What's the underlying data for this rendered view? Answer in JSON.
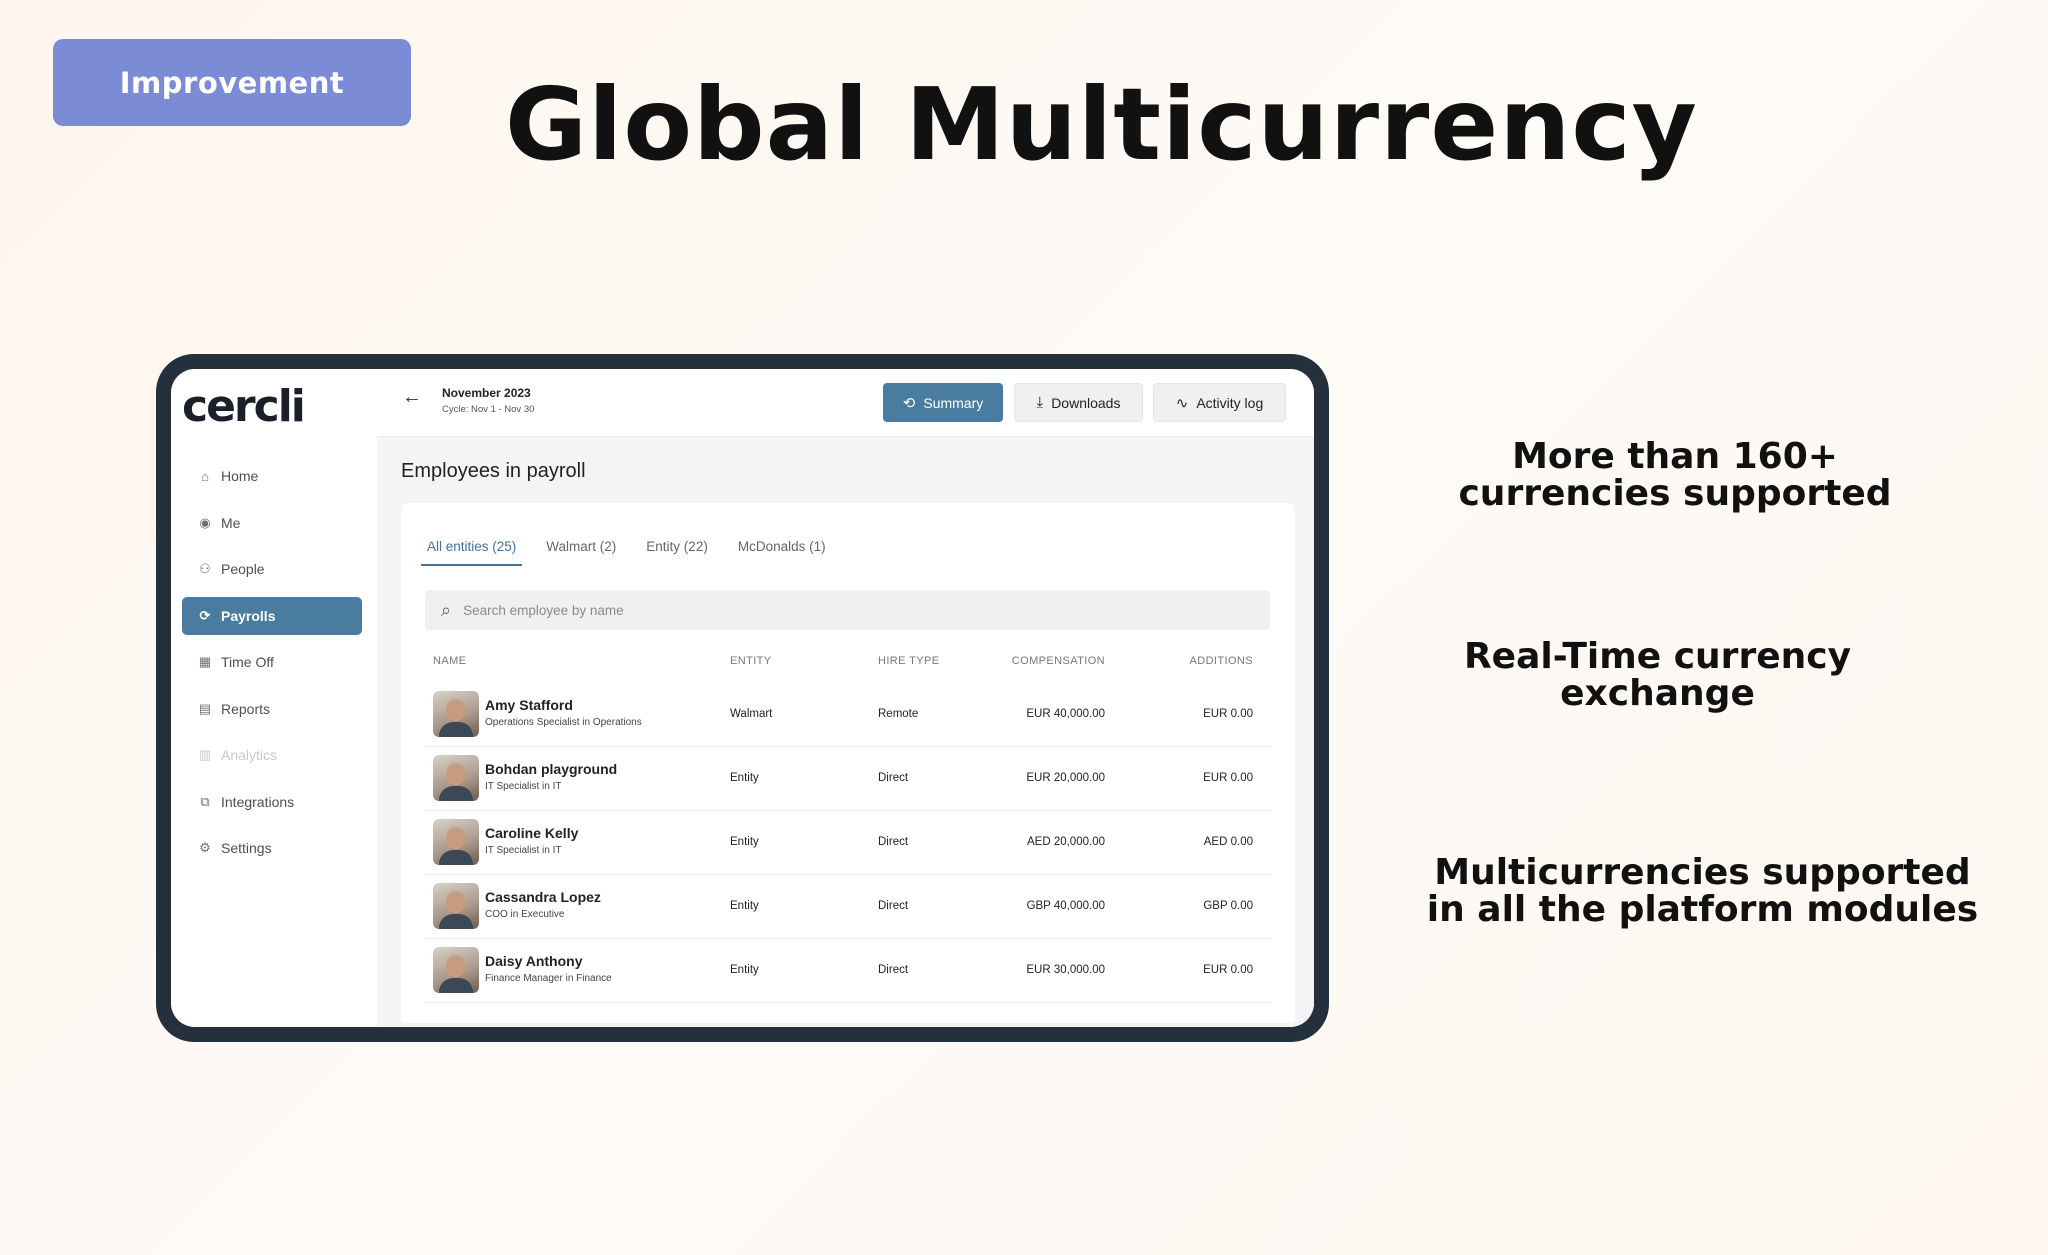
{
  "badge": "Improvement",
  "title": "Global Multicurrency",
  "features": [
    "More than 160+ currencies supported",
    "Real-Time currency exchange",
    "Multicurrencies supported in all the platform modules"
  ],
  "app": {
    "logo": "cercli",
    "nav": [
      {
        "label": "Home",
        "icon": "home-icon"
      },
      {
        "label": "Me",
        "icon": "user-circle-icon"
      },
      {
        "label": "People",
        "icon": "people-icon"
      },
      {
        "label": "Payrolls",
        "icon": "payroll-icon",
        "active": true
      },
      {
        "label": "Time Off",
        "icon": "calendar-icon"
      },
      {
        "label": "Reports",
        "icon": "document-icon"
      },
      {
        "label": "Analytics",
        "icon": "analytics-icon",
        "disabled": true
      },
      {
        "label": "Integrations",
        "icon": "integrations-icon"
      },
      {
        "label": "Settings",
        "icon": "gear-icon"
      }
    ],
    "header": {
      "month": "November 2023",
      "cycle": "Cycle: Nov 1 - Nov 30",
      "summary_label": "Summary",
      "downloads_label": "Downloads",
      "activity_label": "Activity log"
    },
    "section_title": "Employees in payroll",
    "tabs": [
      "All entities (25)",
      "Walmart (2)",
      "Entity (22)",
      "McDonalds (1)"
    ],
    "search_placeholder": "Search employee by name",
    "columns": {
      "name": "NAME",
      "entity": "ENTITY",
      "hire_type": "HIRE TYPE",
      "compensation": "COMPENSATION",
      "additions": "ADDITIONS"
    },
    "employees": [
      {
        "name": "Amy Stafford",
        "role": "Operations Specialist in Operations",
        "entity": "Walmart",
        "hire_type": "Remote",
        "compensation": "EUR 40,000.00",
        "additions": "EUR 0.00"
      },
      {
        "name": "Bohdan playground",
        "role": "IT Specialist in IT",
        "entity": "Entity",
        "hire_type": "Direct",
        "compensation": "EUR 20,000.00",
        "additions": "EUR 0.00"
      },
      {
        "name": "Caroline Kelly",
        "role": "IT Specialist in IT",
        "entity": "Entity",
        "hire_type": "Direct",
        "compensation": "AED 20,000.00",
        "additions": "AED 0.00"
      },
      {
        "name": "Cassandra Lopez",
        "role": "COO in Executive",
        "entity": "Entity",
        "hire_type": "Direct",
        "compensation": "GBP 40,000.00",
        "additions": "GBP 0.00"
      },
      {
        "name": "Daisy Anthony",
        "role": "Finance Manager in Finance",
        "entity": "Entity",
        "hire_type": "Direct",
        "compensation": "EUR 30,000.00",
        "additions": "EUR 0.00"
      }
    ],
    "colors": {
      "accent": "#4a7ba0",
      "badge": "#7b8bd6",
      "frame": "#24313c"
    }
  }
}
